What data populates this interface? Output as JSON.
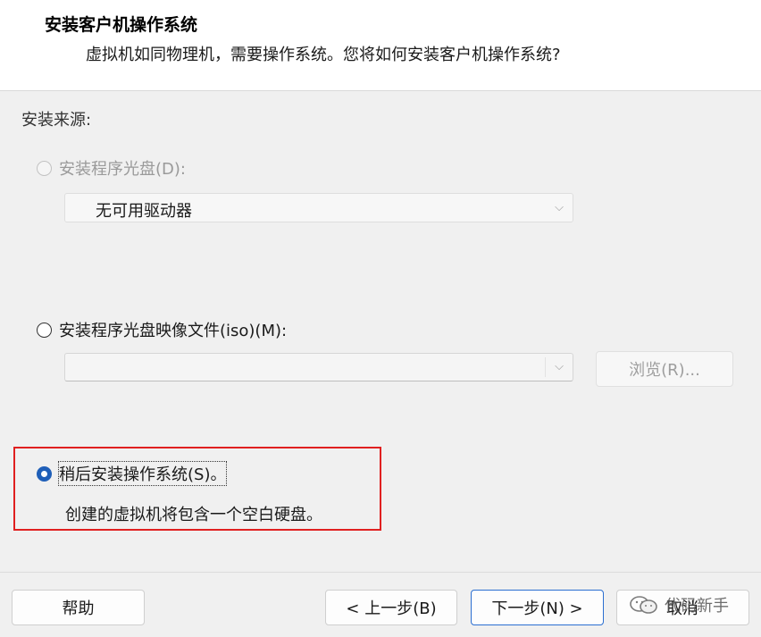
{
  "header": {
    "title": "安装客户机操作系统",
    "subtitle": "虚拟机如同物理机，需要操作系统。您将如何安装客户机操作系统?"
  },
  "source": {
    "label": "安装来源:",
    "disc_option": {
      "label": "安装程序光盘(D):",
      "enabled": false
    },
    "disc_drive_select": {
      "value": "无可用驱动器"
    },
    "iso_option": {
      "label": "安装程序光盘映像文件(iso)(M):",
      "enabled": true
    },
    "iso_path_value": "",
    "browse_label": "浏览(R)...",
    "later_option": {
      "label": "稍后安装操作系统(S)。",
      "selected": true
    },
    "later_description": "创建的虚拟机将包含一个空白硬盘。"
  },
  "footer": {
    "help": "帮助",
    "back": "< 上一步(B)",
    "next": "下一步(N) >",
    "cancel": "取消"
  },
  "watermark": {
    "text": "代码新手",
    "icon": "wechat-icon"
  },
  "colors": {
    "accent": "#1f5fb8",
    "highlight": "#e02020"
  }
}
